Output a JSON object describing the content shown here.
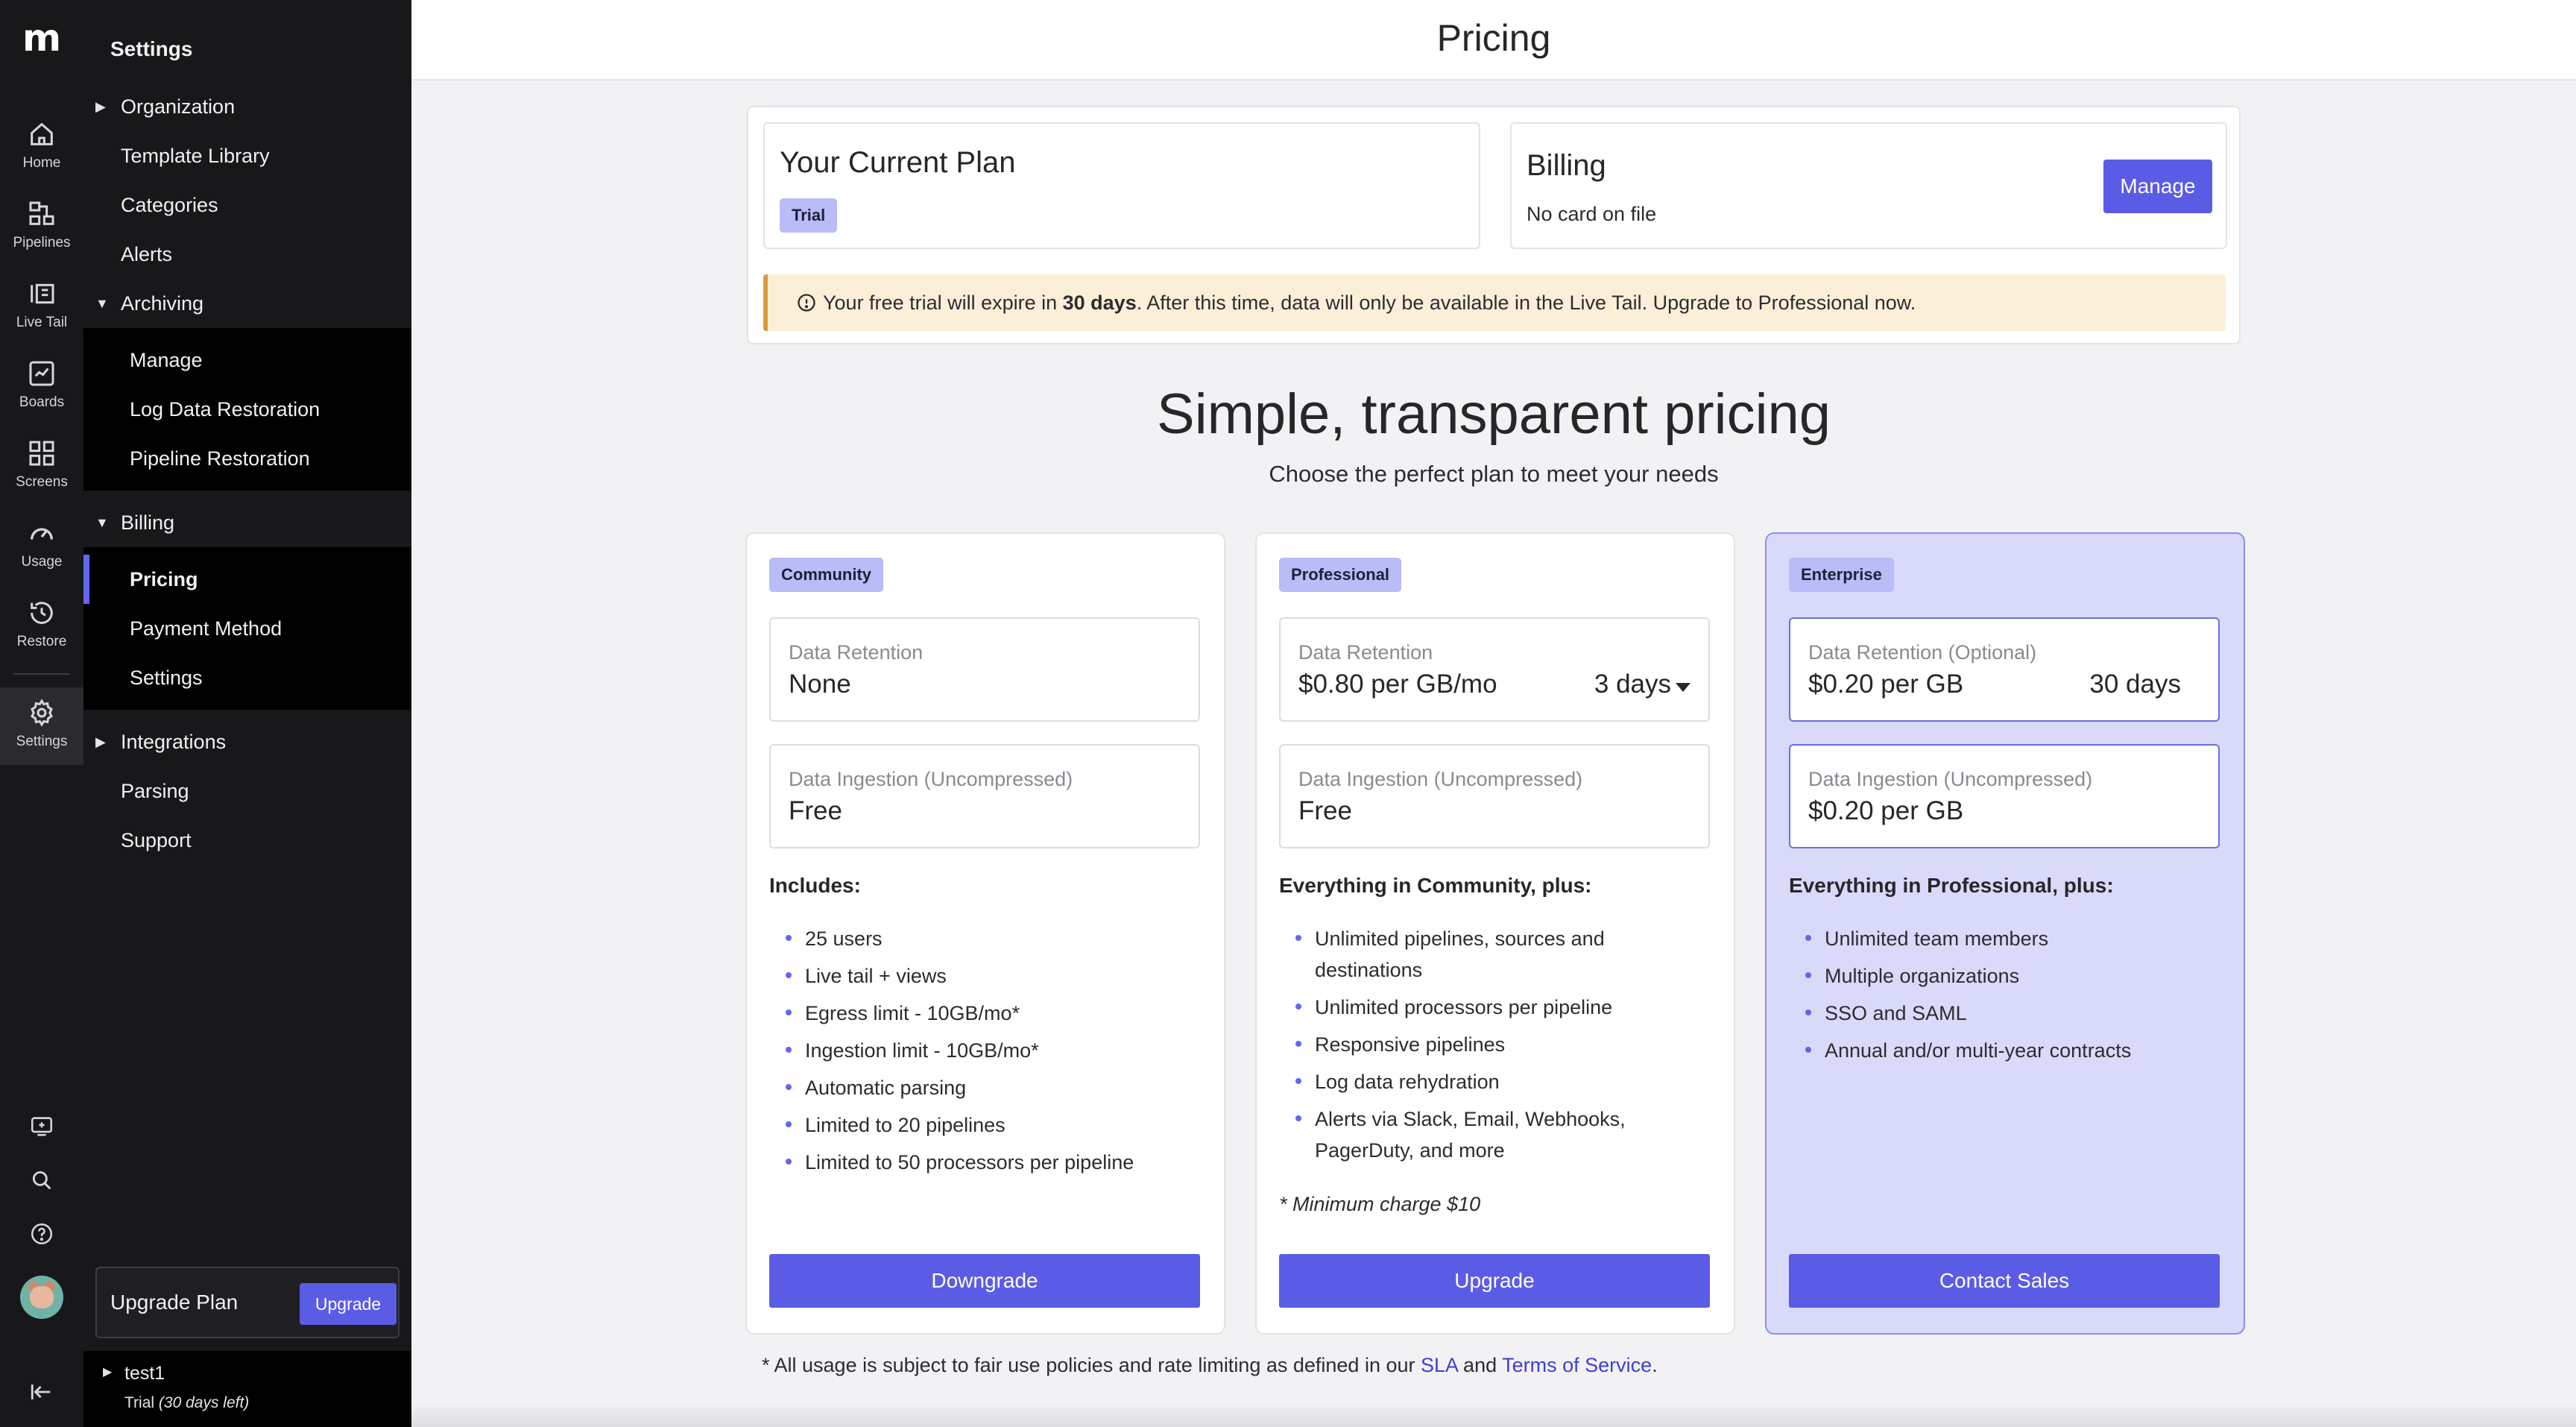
{
  "app": {
    "logo_text": "m"
  },
  "rail": {
    "items": [
      {
        "label": "Home",
        "icon": "home-icon"
      },
      {
        "label": "Pipelines",
        "icon": "pipelines-icon"
      },
      {
        "label": "Live Tail",
        "icon": "live-tail-icon"
      },
      {
        "label": "Boards",
        "icon": "boards-icon"
      },
      {
        "label": "Screens",
        "icon": "screens-icon"
      },
      {
        "label": "Usage",
        "icon": "usage-gauge-icon"
      },
      {
        "label": "Restore",
        "icon": "restore-icon"
      },
      {
        "label": "Settings",
        "icon": "gear-icon",
        "active": true
      }
    ],
    "tools": [
      "feedback-icon",
      "search-icon",
      "help-icon",
      "avatar",
      "collapse-icon"
    ]
  },
  "sidebar": {
    "title": "Settings",
    "items": {
      "organization": "Organization",
      "template_library": "Template Library",
      "categories": "Categories",
      "alerts": "Alerts",
      "archiving": "Archiving",
      "manage": "Manage",
      "log_data_restoration": "Log Data Restoration",
      "pipeline_restoration": "Pipeline Restoration",
      "billing": "Billing",
      "pricing": "Pricing",
      "payment_method": "Payment Method",
      "settings": "Settings",
      "integrations": "Integrations",
      "parsing": "Parsing",
      "support": "Support"
    },
    "upgrade": {
      "label": "Upgrade Plan",
      "button": "Upgrade"
    },
    "org": {
      "name": "test1",
      "status_prefix": "Trial",
      "status_days": "(30 days left)"
    }
  },
  "header": {
    "title": "Pricing"
  },
  "current_plan": {
    "title": "Your Current Plan",
    "badge": "Trial"
  },
  "billing": {
    "title": "Billing",
    "status": "No card on file",
    "manage": "Manage"
  },
  "alert": {
    "prefix": "Your free trial will expire in ",
    "days": "30 days",
    "suffix": ". After this time, data will only be available in the Live Tail. Upgrade to Professional now."
  },
  "hero": {
    "title": "Simple, transparent pricing",
    "subtitle": "Choose the perfect plan to meet your needs"
  },
  "tiers": [
    {
      "badge": "Community",
      "retention_label": "Data Retention",
      "retention_value": "None",
      "retention_days": "",
      "ingestion_label": "Data Ingestion (Uncompressed)",
      "ingestion_value": "Free",
      "includes_title": "Includes:",
      "features": [
        "25 users",
        "Live tail + views",
        "Egress limit - 10GB/mo*",
        "Ingestion limit - 10GB/mo*",
        "Automatic parsing",
        "Limited to 20 pipelines",
        "Limited to 50 processors per pipeline"
      ],
      "note": "",
      "button": "Downgrade"
    },
    {
      "badge": "Professional",
      "retention_label": "Data Retention",
      "retention_value": "$0.80 per GB/mo",
      "retention_days": "3 days",
      "ingestion_label": "Data Ingestion (Uncompressed)",
      "ingestion_value": "Free",
      "includes_title": "Everything in Community, plus:",
      "features": [
        "Unlimited pipelines, sources and destinations",
        "Unlimited processors per pipeline",
        "Responsive pipelines",
        "Log data rehydration",
        "Alerts via Slack, Email, Webhooks, PagerDuty, and more"
      ],
      "note": "* Minimum charge $10",
      "button": "Upgrade"
    },
    {
      "badge": "Enterprise",
      "retention_label": "Data Retention (Optional)",
      "retention_value": "$0.20 per GB",
      "retention_days": "30 days",
      "ingestion_label": "Data Ingestion (Uncompressed)",
      "ingestion_value": "$0.20 per GB",
      "includes_title": "Everything in Professional, plus:",
      "features": [
        "Unlimited team members",
        "Multiple organizations",
        "SSO and SAML",
        "Annual and/or multi-year contracts"
      ],
      "note": "",
      "button": "Contact Sales"
    }
  ],
  "footnote": {
    "prefix": "* All usage is subject to fair use policies and rate limiting as defined in our ",
    "sla": "SLA",
    "and": " and ",
    "tos": "Terms of Service",
    "suffix": "."
  },
  "colors": {
    "accent": "#5b5ce6",
    "sidebar_bg": "#18181b",
    "alert_bg": "#fcefd8",
    "enterprise_bg": "#d9daf9"
  }
}
